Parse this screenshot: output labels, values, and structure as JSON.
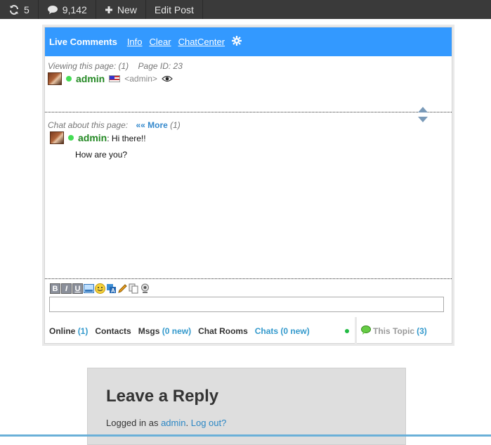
{
  "adminbar": {
    "updates_count": "5",
    "comments_count": "9,142",
    "new_label": "New",
    "edit_label": "Edit Post"
  },
  "live_comments": {
    "title": "Live Comments",
    "links": [
      "Info",
      "Clear",
      "ChatCenter"
    ],
    "viewing_label": "Viewing this page: (1)",
    "page_id_label": "Page ID: 23",
    "viewer": {
      "name": "admin",
      "role": "<admin>"
    },
    "chat_about_label": "Chat about this page:",
    "more_label": "«« More",
    "more_count": "(1)",
    "message": {
      "author": "admin",
      "line1": ": Hi there!!",
      "line2": "How are you?"
    },
    "input_value": "",
    "tabs": {
      "online": "Online",
      "online_count": "(1)",
      "contacts": "Contacts",
      "msgs": "Msgs",
      "msgs_count": "(0 new)",
      "chat_rooms": "Chat Rooms",
      "chats": "Chats (0 new)"
    },
    "this_topic": "This Topic",
    "this_topic_count": "(3)",
    "accent_color": "#3399ff"
  },
  "reply": {
    "title": "Leave a Reply",
    "logged_prefix": "Logged in as",
    "user_link": "admin",
    "logout_link": "Log out?"
  }
}
